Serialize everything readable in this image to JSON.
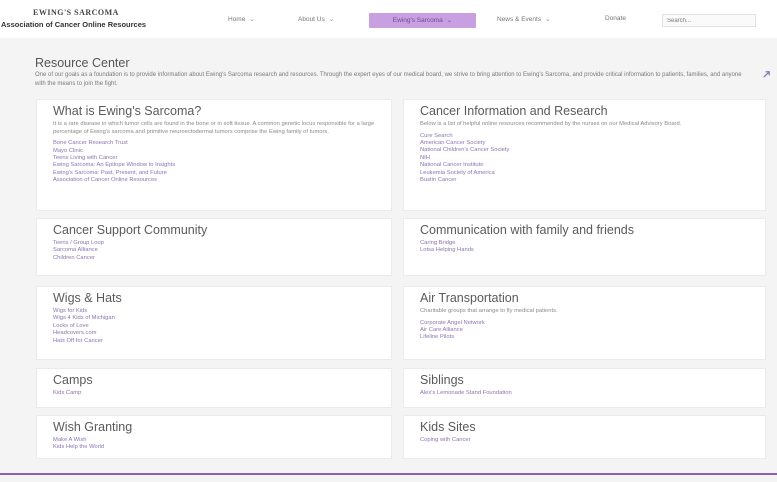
{
  "header": {
    "logo_top": "EWING'S SARCOMA",
    "logo_bottom": "Association of Cancer Online Resources",
    "nav": [
      {
        "label": "Home"
      },
      {
        "label": "About Us"
      },
      {
        "label": "Ewing's Sarcoma"
      },
      {
        "label": "News & Events"
      },
      {
        "label": "Donate"
      }
    ],
    "nav_caret": "⌄",
    "search_placeholder": "Search...",
    "active_nav_color": "#c8a0e1"
  },
  "page": {
    "title": "Resource Center",
    "intro": "One of our goals as a foundation is to provide information about Ewing's Sarcoma research and resources. Through the expert eyes of our medical board, we strive to bring attention to Ewing's Sarcoma, and provide critical information to patients, families, and anyone with the means to join the fight."
  },
  "cards": [
    {
      "title": "What is Ewing's Sarcoma?",
      "desc": "It is a rare disease in which tumor cells are found in the bone or in soft tissue. A common genetic locus responsible for a large percentage of Ewing's sarcoma and primitive neuroectodermal tumors comprise the Ewing family of tumors.",
      "links": [
        "Bone Cancer Research Trust",
        "Mayo Clinic",
        "Teens Living with Cancer",
        "Ewing Sarcoma: An Epitope Window to Insights",
        "Ewing's Sarcoma: Past, Present, and Future",
        "Association of Cancer Online Resources"
      ]
    },
    {
      "title": "Cancer Information and Research",
      "desc": "Below is a list of helpful online resources recommended by the nurses on our Medical Advisory Board.",
      "links": [
        "Cure Search",
        "American Cancer Society",
        "National Children's Cancer Society",
        "NIH",
        "National Cancer Institute",
        "Leukemia Society of America",
        "Bustin Cancer"
      ]
    },
    {
      "title": "Cancer Support Community",
      "desc": "",
      "links": [
        "Teens / Group Loop",
        "Sarcoma Alliance",
        "Children Cancer"
      ]
    },
    {
      "title": "Communication with family and friends",
      "desc": "",
      "links": [
        "Caring Bridge",
        "Lotsa Helping Hands"
      ]
    },
    {
      "title": "Wigs & Hats",
      "desc": "",
      "links": [
        "Wigs for Kids",
        "Wigs 4 Kids of Michigan",
        "Locks of Love",
        "Headcovers.com",
        "Hats Off for Cancer"
      ]
    },
    {
      "title": "Air Transportation",
      "desc": "Charitable groups that arrange to fly medical patients.",
      "links": [
        "Corporate Angel Network",
        "Air Care Alliance",
        "Lifeline Pilots"
      ]
    },
    {
      "title": "Camps",
      "desc": "",
      "links": [
        "Kids Camp"
      ]
    },
    {
      "title": "Siblings",
      "desc": "",
      "links": [
        "Alex's Lemonade Stand Foundation"
      ]
    },
    {
      "title": "Wish Granting",
      "desc": "",
      "links": [
        "Make A Wish",
        "Kids Help the World"
      ]
    },
    {
      "title": "Kids Sites",
      "desc": "",
      "links": [
        "Coping with Cancer"
      ]
    }
  ],
  "theme": {
    "accent": "#8d5fb6",
    "link": "#8d74b0",
    "background": "#f4f4f4"
  },
  "icons": {
    "edge_icon": "arrow-icon"
  }
}
